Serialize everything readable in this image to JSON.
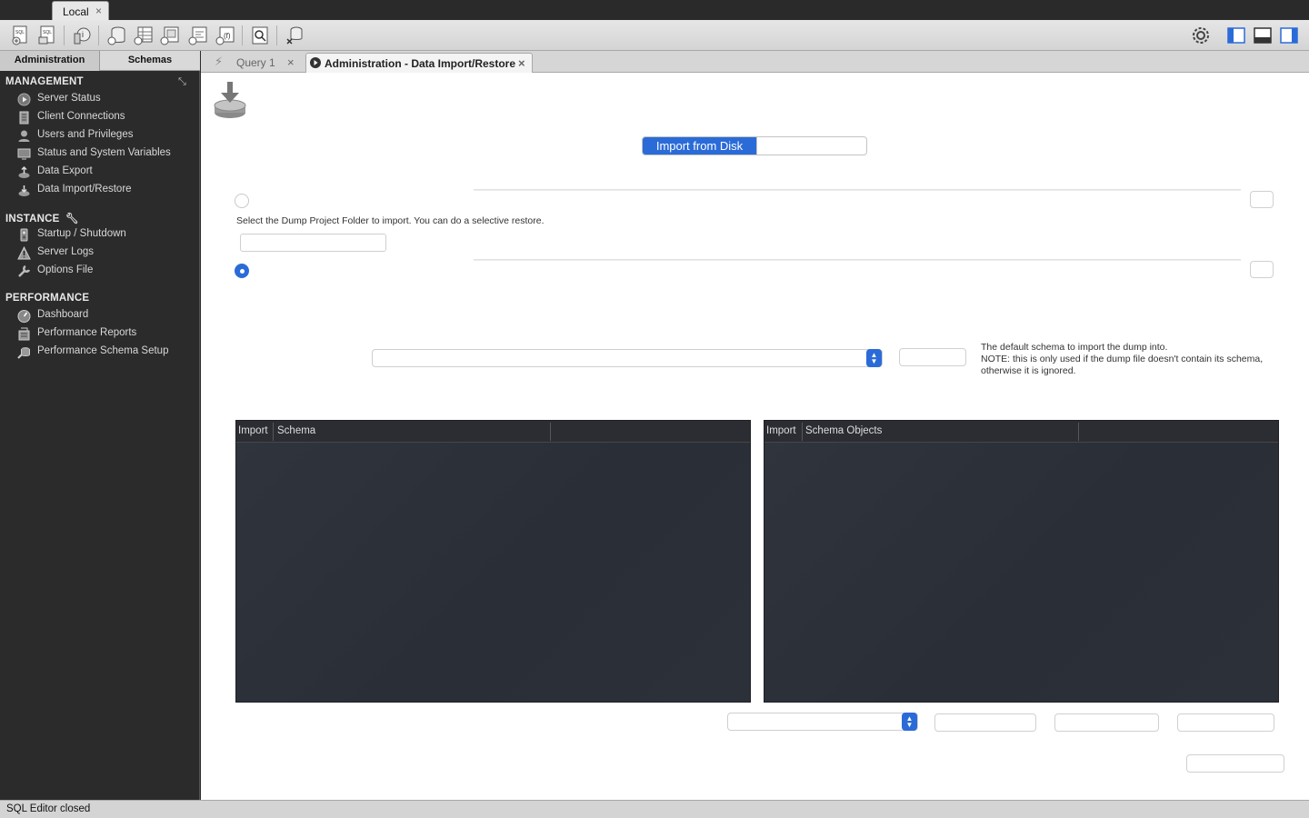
{
  "connection_tab": {
    "label": "Local",
    "close": "×"
  },
  "sidebar": {
    "tabs": {
      "admin": "Administration",
      "schemas": "Schemas"
    },
    "sections": [
      {
        "title": "MANAGEMENT",
        "items": [
          {
            "label": "Server Status",
            "icon": "play-circle-icon"
          },
          {
            "label": "Client Connections",
            "icon": "connections-icon"
          },
          {
            "label": "Users and Privileges",
            "icon": "user-icon"
          },
          {
            "label": "Status and System Variables",
            "icon": "monitor-icon"
          },
          {
            "label": "Data Export",
            "icon": "export-icon"
          },
          {
            "label": "Data Import/Restore",
            "icon": "import-icon"
          }
        ]
      },
      {
        "title": "INSTANCE",
        "items": [
          {
            "label": "Startup / Shutdown",
            "icon": "power-icon"
          },
          {
            "label": "Server Logs",
            "icon": "warning-icon"
          },
          {
            "label": "Options File",
            "icon": "wrench-icon"
          }
        ]
      },
      {
        "title": "PERFORMANCE",
        "items": [
          {
            "label": "Dashboard",
            "icon": "dashboard-icon"
          },
          {
            "label": "Performance Reports",
            "icon": "reports-icon"
          },
          {
            "label": "Performance Schema Setup",
            "icon": "setup-icon"
          }
        ]
      }
    ]
  },
  "doc_tabs": {
    "query": {
      "label": "Query 1",
      "close": "×"
    },
    "import": {
      "label": "Administration - Data Import/Restore",
      "close": "×"
    }
  },
  "import": {
    "mode_tabs": [
      "Import from Disk",
      ""
    ],
    "folder_help": "Select the Dump Project Folder to import. You can do a selective restore.",
    "schema_help": [
      "The default schema to import the dump into.",
      "NOTE: this is only used if the dump file doesn't contain its schema,",
      "otherwise it is ignored."
    ],
    "schema_panel": {
      "columns": [
        "Import",
        "Schema"
      ]
    },
    "objects_panel": {
      "columns": [
        "Import",
        "Schema Objects"
      ]
    }
  },
  "status_bar": {
    "text": "SQL Editor closed"
  },
  "colors": {
    "accent": "#2a6bd8",
    "sidebar_bg": "#2b2b2b",
    "panel_bg": "#2e323a"
  }
}
